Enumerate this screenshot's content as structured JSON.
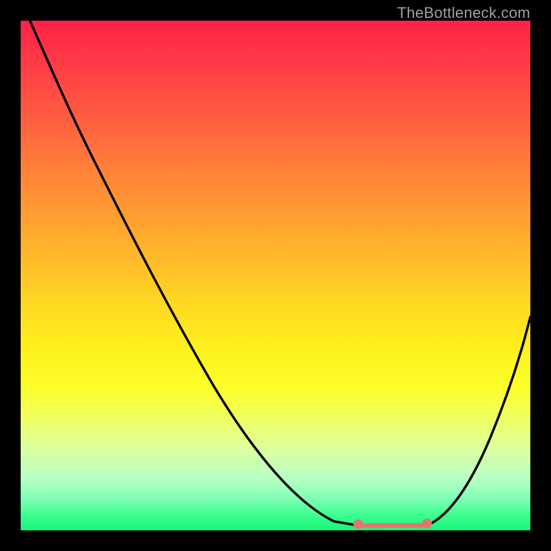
{
  "watermark": "TheBottleneck.com",
  "chart_data": {
    "type": "line",
    "title": "",
    "xlabel": "",
    "ylabel": "",
    "xlim": [
      0,
      100
    ],
    "ylim": [
      0,
      100
    ],
    "x": [
      0,
      4,
      8,
      12,
      16,
      20,
      24,
      28,
      32,
      36,
      40,
      44,
      48,
      52,
      56,
      60,
      64,
      68,
      72,
      76,
      80,
      84,
      88,
      92,
      96,
      100
    ],
    "values": [
      100,
      95,
      90,
      84,
      78,
      72,
      66,
      60,
      54,
      47,
      41,
      35,
      28,
      22,
      15,
      9,
      4,
      1,
      0,
      0,
      1,
      4,
      11,
      20,
      31,
      42
    ],
    "optimal_range_x": [
      66,
      80
    ],
    "markers": [
      {
        "x": 66,
        "y": 1,
        "color": "#e2766f"
      },
      {
        "x": 80,
        "y": 1.5,
        "color": "#e2766f"
      }
    ],
    "colors": {
      "curve": "#000000",
      "flat_segment": "#e2766f",
      "background_top": "#ff2247",
      "background_bottom": "#18f57a"
    }
  }
}
